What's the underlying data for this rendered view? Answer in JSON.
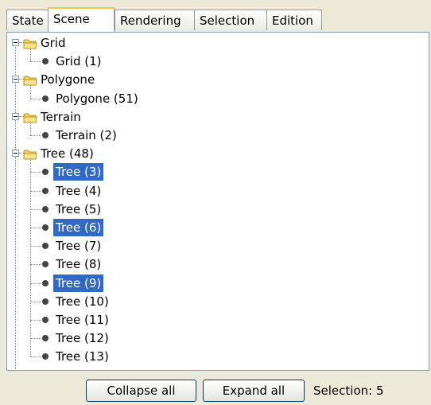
{
  "tabs": [
    {
      "label": "State",
      "active": false
    },
    {
      "label": "Scene",
      "active": true
    },
    {
      "label": "Rendering",
      "active": false
    },
    {
      "label": "Selection",
      "active": false
    },
    {
      "label": "Edition",
      "active": false
    }
  ],
  "tree": {
    "groups": [
      {
        "label": "Grid",
        "children": [
          {
            "label": "Grid (1)",
            "selected": false
          }
        ]
      },
      {
        "label": "Polygone",
        "children": [
          {
            "label": "Polygone (51)",
            "selected": false
          }
        ]
      },
      {
        "label": "Terrain",
        "children": [
          {
            "label": "Terrain (2)",
            "selected": false
          }
        ]
      },
      {
        "label": "Tree (48)",
        "children": [
          {
            "label": "Tree (3)",
            "selected": true
          },
          {
            "label": "Tree (4)",
            "selected": false
          },
          {
            "label": "Tree (5)",
            "selected": false
          },
          {
            "label": "Tree (6)",
            "selected": true
          },
          {
            "label": "Tree (7)",
            "selected": false
          },
          {
            "label": "Tree (8)",
            "selected": false
          },
          {
            "label": "Tree (9)",
            "selected": true
          },
          {
            "label": "Tree (10)",
            "selected": false
          },
          {
            "label": "Tree (11)",
            "selected": false
          },
          {
            "label": "Tree (12)",
            "selected": false
          },
          {
            "label": "Tree (13)",
            "selected": false
          }
        ]
      }
    ]
  },
  "buttons": {
    "collapse_all": "Collapse all",
    "expand_all": "Expand all"
  },
  "status": {
    "selection": "Selection: 5"
  },
  "colors": {
    "selection": "#316ac5",
    "folder": "#f7d35c",
    "tab_highlight": "#ffc83c"
  }
}
